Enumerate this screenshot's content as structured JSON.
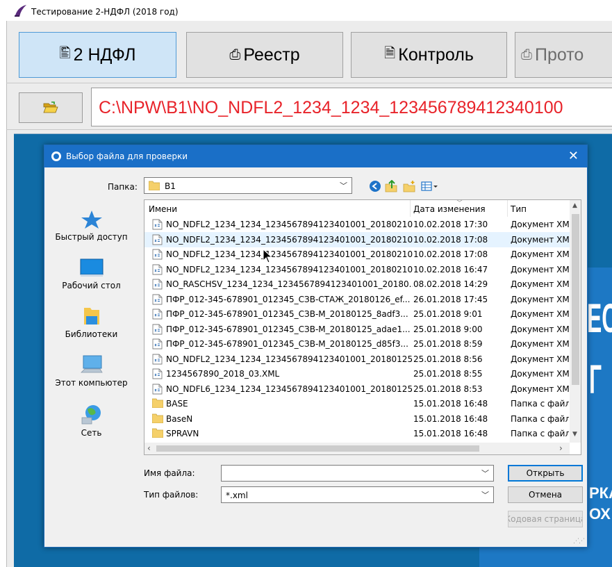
{
  "app": {
    "title": "Тестирование 2-НДФЛ (2018 год)",
    "tabs": [
      {
        "label": "2 НДФЛ",
        "active": true
      },
      {
        "label": "Реестр",
        "active": false
      },
      {
        "label": "Контроль",
        "active": false
      },
      {
        "label": "Прото",
        "active": false
      }
    ],
    "path": "C:\\NPW\\B1\\NO_NDFL2_1234_1234_123456789412340100",
    "banner": [
      "ЕСТ",
      "Г",
      "РКА",
      "ОХ"
    ]
  },
  "dialog": {
    "title": "Выбор файла для проверки",
    "close_glyph": "✕",
    "folder_label": "Папка:",
    "folder_value": "B1",
    "places": [
      "Быстрый доступ",
      "Рабочий стол",
      "Библиотеки",
      "Этот компьютер",
      "Сеть"
    ],
    "columns": {
      "name": "Имени",
      "date": "Дата изменения",
      "type": "Тип"
    },
    "files": [
      {
        "name": "NO_NDFL2_1234_1234_1234567894123401001_20180210...",
        "date": "10.02.2018 17:30",
        "type": "Документ XM",
        "kind": "xml"
      },
      {
        "name": "NO_NDFL2_1234_1234_1234567894123401001_20180210...",
        "date": "10.02.2018 17:08",
        "type": "Документ XM",
        "kind": "xml",
        "selected": true
      },
      {
        "name": "NO_NDFL2_1234_1234_1234567894123401001_20180210...",
        "date": "10.02.2018 17:08",
        "type": "Документ XM",
        "kind": "xml"
      },
      {
        "name": "NO_NDFL2_1234_1234_1234567894123401001_20180210...",
        "date": "10.02.2018 16:47",
        "type": "Документ XM",
        "kind": "xml"
      },
      {
        "name": "NO_RASCHSV_1234_1234_1234567894123401001_20180...",
        "date": "08.02.2018 14:29",
        "type": "Документ XM",
        "kind": "xml"
      },
      {
        "name": "ПФР_012-345-678901_012345_СЗВ-СТАЖ_20180126_ef...",
        "date": "26.01.2018 17:45",
        "type": "Документ XM",
        "kind": "xml"
      },
      {
        "name": "ПФР_012-345-678901_012345_СЗВ-М_20180125_8adf3...",
        "date": "25.01.2018 9:01",
        "type": "Документ XM",
        "kind": "xml"
      },
      {
        "name": "ПФР_012-345-678901_012345_СЗВ-М_20180125_adae1...",
        "date": "25.01.2018 9:00",
        "type": "Документ XM",
        "kind": "xml"
      },
      {
        "name": "ПФР_012-345-678901_012345_СЗВ-М_20180125_d85f3...",
        "date": "25.01.2018 8:59",
        "type": "Документ XM",
        "kind": "xml"
      },
      {
        "name": "NO_NDFL2_1234_1234_1234567894123401001_20180125...",
        "date": "25.01.2018 8:56",
        "type": "Документ XM",
        "kind": "xml"
      },
      {
        "name": "1234567890_2018_03.XML",
        "date": "25.01.2018 8:55",
        "type": "Документ XM",
        "kind": "xml"
      },
      {
        "name": "NO_NDFL6_1234_1234_1234567894123401001_20180125...",
        "date": "25.01.2018 8:53",
        "type": "Документ XM",
        "kind": "xml"
      },
      {
        "name": "BASE",
        "date": "15.01.2018 16:48",
        "type": "Папка с файл",
        "kind": "folder"
      },
      {
        "name": "BaseN",
        "date": "15.01.2018 16:48",
        "type": "Папка с файл",
        "kind": "folder"
      },
      {
        "name": "SPRAVN",
        "date": "15.01.2018 16:48",
        "type": "Папка с файл",
        "kind": "folder"
      }
    ],
    "file_name_label": "Имя файла:",
    "file_name_value": "",
    "file_type_label": "Тип файлов:",
    "file_type_value": "*.xml",
    "buttons": {
      "open": "Открыть",
      "cancel": "Отмена",
      "home": "Кодовая страница"
    }
  },
  "colors": {
    "accent": "#1a6fc7",
    "path_text": "#e8232a",
    "background_blue": "#0f6ba6",
    "selection": "#e5f3ff"
  },
  "icons": [
    "app-logo-icon",
    "folder-open-icon",
    "back-icon",
    "up-folder-icon",
    "new-folder-icon",
    "view-menu-icon",
    "quick-access-icon",
    "desktop-icon",
    "libraries-icon",
    "computer-icon",
    "network-icon",
    "xml-file-icon",
    "folder-icon"
  ]
}
